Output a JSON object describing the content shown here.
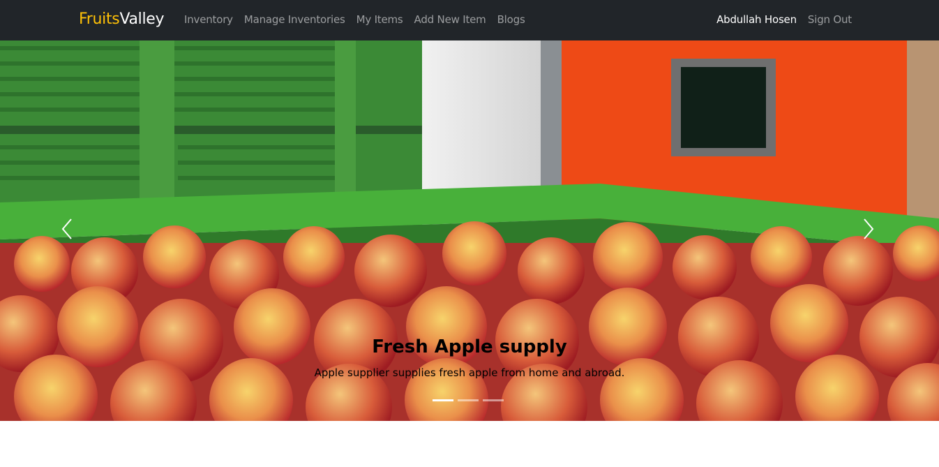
{
  "brand": {
    "part1": "Fruits",
    "part2": "Valley"
  },
  "nav": {
    "links": [
      "Inventory",
      "Manage Inventories",
      "My Items",
      "Add New Item",
      "Blogs"
    ],
    "user_name": "Abdullah Hosen",
    "signout_label": "Sign Out"
  },
  "carousel": {
    "title": "Fresh Apple supply",
    "subtitle": "Apple supplier supplies fresh apple from home and abroad.",
    "prev_icon": "chevron-left-icon",
    "next_icon": "chevron-right-icon",
    "slides_count": 3,
    "active_slide": 1
  },
  "colors": {
    "brand_accent": "#ffc107",
    "navbar_bg": "#212529",
    "link_muted": "rgba(255,255,255,0.55)"
  }
}
